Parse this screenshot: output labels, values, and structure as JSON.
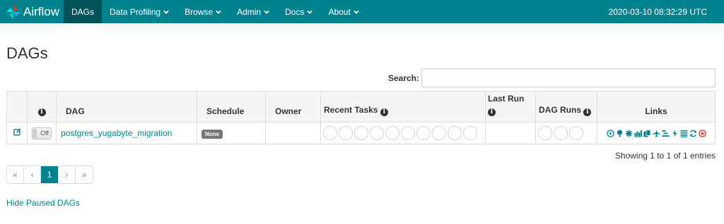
{
  "navbar": {
    "brand": "Airflow",
    "items": [
      {
        "label": "DAGs",
        "dropdown": false,
        "active": true
      },
      {
        "label": "Data Profiling",
        "dropdown": true
      },
      {
        "label": "Browse",
        "dropdown": true
      },
      {
        "label": "Admin",
        "dropdown": true
      },
      {
        "label": "Docs",
        "dropdown": true
      },
      {
        "label": "About",
        "dropdown": true
      }
    ],
    "clock": "2020-03-10 08:32:29 UTC"
  },
  "page": {
    "title": "DAGs"
  },
  "search": {
    "label": "Search:",
    "value": ""
  },
  "table": {
    "headers": {
      "dag": "DAG",
      "schedule": "Schedule",
      "owner": "Owner",
      "recent_tasks": "Recent Tasks",
      "last_run_line1": "Last Run",
      "dag_runs": "DAG Runs",
      "links": "Links"
    },
    "rows": [
      {
        "toggle": "Off",
        "dag_id": "postgres_yugabyte_migration",
        "schedule": "None",
        "owner": "",
        "last_run": "",
        "recent_tasks_count": 10,
        "dag_runs_count": 3
      }
    ],
    "link_icons": [
      "trigger-dag-icon",
      "tree-view-icon",
      "graph-view-icon",
      "task-duration-icon",
      "task-tries-icon",
      "landing-times-icon",
      "gantt-icon",
      "code-icon",
      "logs-icon",
      "refresh-icon",
      "delete-icon"
    ]
  },
  "footer": {
    "showing": "Showing 1 to 1 of 1 entries",
    "pagination": [
      "«",
      "‹",
      "1",
      "›",
      "»"
    ],
    "active_page": "1",
    "hide_paused": "Hide Paused DAGs"
  },
  "colors": {
    "navbar": "#00838f",
    "navbar_active": "#01535a",
    "link": "#00838f",
    "delete": "#e53935"
  }
}
